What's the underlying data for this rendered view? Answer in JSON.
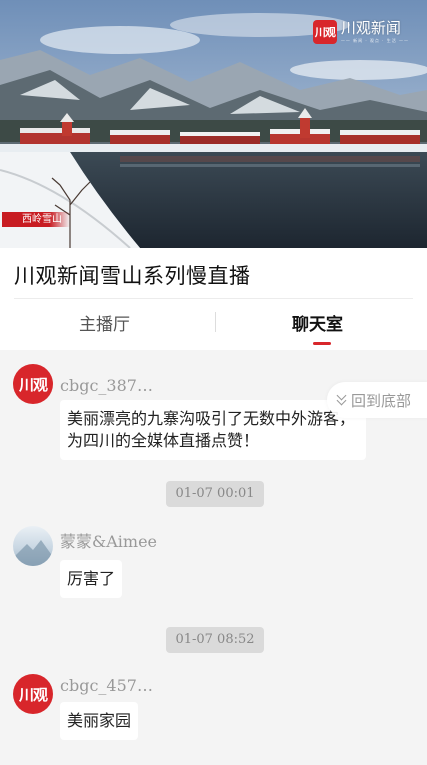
{
  "video": {
    "brand_badge": "川观",
    "brand_name": "川观新闻",
    "brand_sub": "—— 新闻 · 观点 · 生活 ——",
    "caption": "西岭雪山"
  },
  "header": {
    "title": "川观新闻雪山系列慢直播",
    "tabs": [
      {
        "label": "主播厅",
        "active": false
      },
      {
        "label": "聊天室",
        "active": true
      }
    ]
  },
  "back_to_bottom": {
    "label": "回到底部",
    "icon": "double-chevron-down-icon"
  },
  "chat": {
    "messages": [
      {
        "type": "message",
        "avatar": "brand",
        "avatar_text": "川观",
        "user": "cbgc_387…",
        "text_lines": [
          "美丽漂亮的九寨沟吸引了无数中外游客，",
          "为四川的全媒体直播点赞！"
        ]
      },
      {
        "type": "time",
        "text": "01-07 00:01"
      },
      {
        "type": "message",
        "avatar": "photo",
        "user": "蒙蒙&Aimee",
        "text_lines": [
          "厉害了"
        ]
      },
      {
        "type": "time",
        "text": "01-07 08:52"
      },
      {
        "type": "message",
        "avatar": "brand",
        "avatar_text": "川观",
        "user": "cbgc_457…",
        "text_lines": [
          "美丽家园"
        ]
      }
    ]
  },
  "colors": {
    "accent": "#d8262b",
    "chat_bg": "#f4f4f4",
    "time_bg": "#dadada"
  }
}
